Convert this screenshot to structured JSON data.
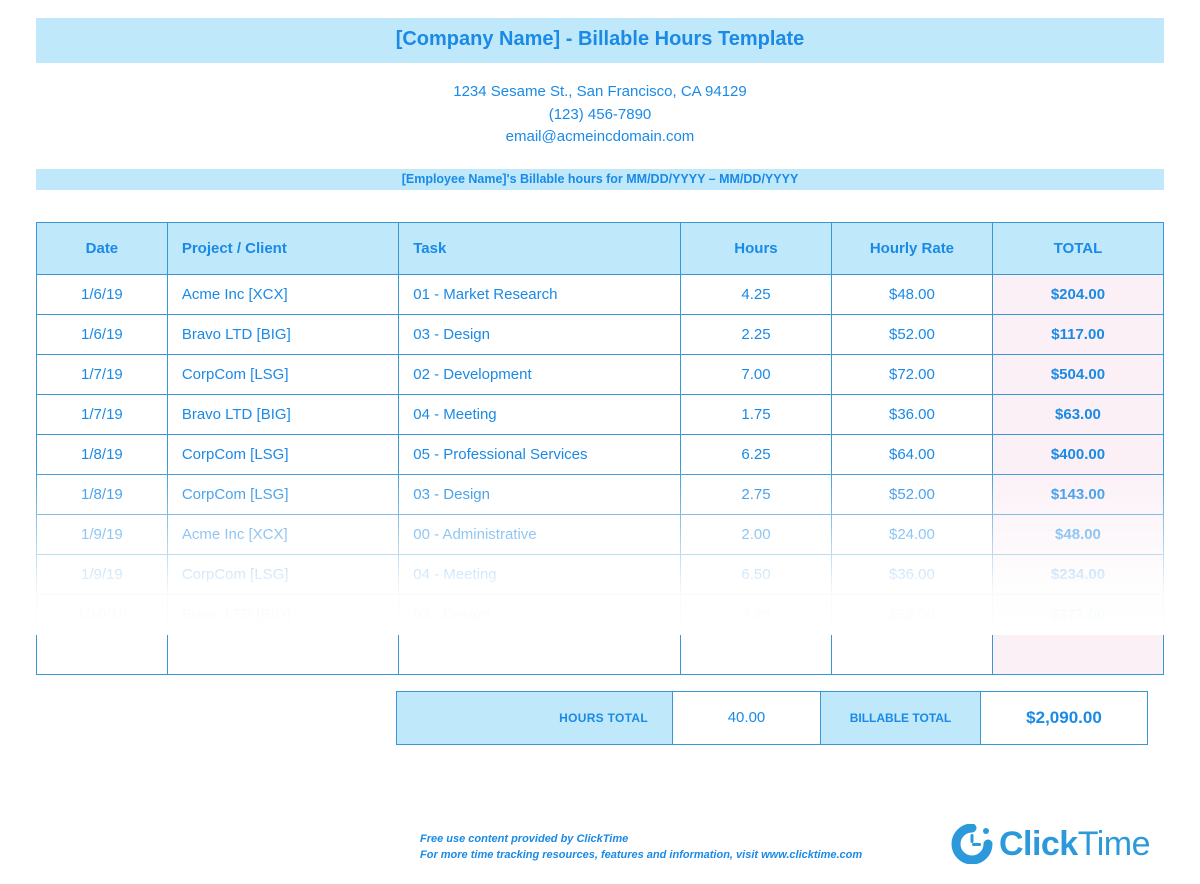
{
  "header": {
    "title": "[Company Name] - Billable Hours Template",
    "address": "1234 Sesame St.,  San Francisco, CA 94129",
    "phone": "(123) 456-7890",
    "email": "email@acmeincdomain.com",
    "subtitle": "[Employee Name]'s Billable hours for MM/DD/YYYY – MM/DD/YYYY"
  },
  "columns": {
    "date": "Date",
    "client": "Project / Client",
    "task": "Task",
    "hours": "Hours",
    "rate": "Hourly Rate",
    "total": "TOTAL"
  },
  "rows": [
    {
      "date": "1/6/19",
      "client": "Acme Inc [XCX]",
      "task": "01 - Market Research",
      "hours": "4.25",
      "rate": "$48.00",
      "total": "$204.00"
    },
    {
      "date": "1/6/19",
      "client": "Bravo LTD [BIG]",
      "task": "03 - Design",
      "hours": "2.25",
      "rate": "$52.00",
      "total": "$117.00"
    },
    {
      "date": "1/7/19",
      "client": "CorpCom [LSG]",
      "task": "02 - Development",
      "hours": "7.00",
      "rate": "$72.00",
      "total": "$504.00"
    },
    {
      "date": "1/7/19",
      "client": "Bravo LTD [BIG]",
      "task": "04 - Meeting",
      "hours": "1.75",
      "rate": "$36.00",
      "total": "$63.00"
    },
    {
      "date": "1/8/19",
      "client": "CorpCom [LSG]",
      "task": "05 - Professional Services",
      "hours": "6.25",
      "rate": "$64.00",
      "total": "$400.00"
    },
    {
      "date": "1/8/19",
      "client": "CorpCom [LSG]",
      "task": "03 - Design",
      "hours": "2.75",
      "rate": "$52.00",
      "total": "$143.00"
    },
    {
      "date": "1/9/19",
      "client": "Acme Inc [XCX]",
      "task": "00 - Administrative",
      "hours": "2.00",
      "rate": "$24.00",
      "total": "$48.00"
    },
    {
      "date": "1/9/19",
      "client": "CorpCom [LSG]",
      "task": "04 - Meeting",
      "hours": "6.50",
      "rate": "$36.00",
      "total": "$234.00"
    },
    {
      "date": "1/10/19",
      "client": "Bravo LTD [BIG]",
      "task": "03 - Design",
      "hours": "7.25",
      "rate": "$52.00",
      "total": "$377.00"
    }
  ],
  "totals": {
    "hours_label": "HOURS TOTAL",
    "hours_value": "40.00",
    "billable_label": "BILLABLE TOTAL",
    "billable_value": "$2,090.00"
  },
  "footer": {
    "line1": "Free use content provided by ClickTime",
    "line2": "For more time tracking resources, features and information, visit www.clicktime.com",
    "brand_bold": "Click",
    "brand_light": "Time"
  },
  "chart_data": {
    "type": "table",
    "columns": [
      "Date",
      "Project / Client",
      "Task",
      "Hours",
      "Hourly Rate",
      "TOTAL"
    ],
    "rows": [
      [
        "1/6/19",
        "Acme Inc [XCX]",
        "01 - Market Research",
        4.25,
        48.0,
        204.0
      ],
      [
        "1/6/19",
        "Bravo LTD [BIG]",
        "03 - Design",
        2.25,
        52.0,
        117.0
      ],
      [
        "1/7/19",
        "CorpCom [LSG]",
        "02 - Development",
        7.0,
        72.0,
        504.0
      ],
      [
        "1/7/19",
        "Bravo LTD [BIG]",
        "04 - Meeting",
        1.75,
        36.0,
        63.0
      ],
      [
        "1/8/19",
        "CorpCom [LSG]",
        "05 - Professional Services",
        6.25,
        64.0,
        400.0
      ],
      [
        "1/8/19",
        "CorpCom [LSG]",
        "03 - Design",
        2.75,
        52.0,
        143.0
      ],
      [
        "1/9/19",
        "Acme Inc [XCX]",
        "00 - Administrative",
        2.0,
        24.0,
        48.0
      ],
      [
        "1/9/19",
        "CorpCom [LSG]",
        "04 - Meeting",
        6.5,
        36.0,
        234.0
      ],
      [
        "1/10/19",
        "Bravo LTD [BIG]",
        "03 - Design",
        7.25,
        52.0,
        377.0
      ]
    ],
    "totals": {
      "hours": 40.0,
      "billable": 2090.0
    }
  }
}
